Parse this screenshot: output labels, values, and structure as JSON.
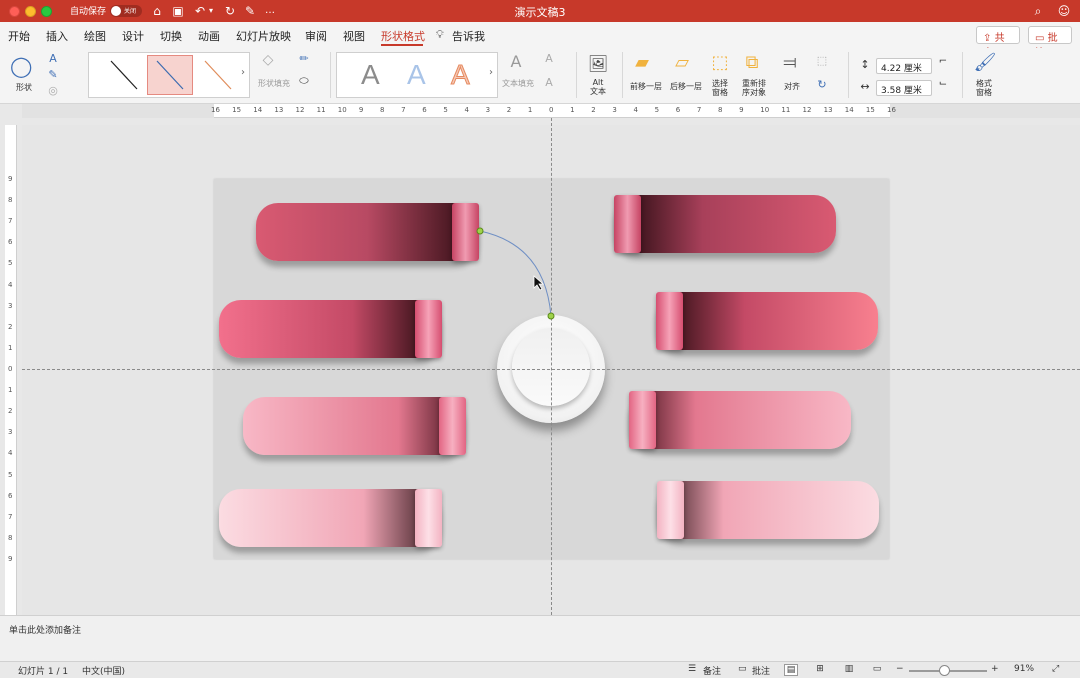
{
  "titlebar": {
    "autosave_label": "自动保存",
    "autosave_state": "关闭",
    "doc_title": "演示文稿3"
  },
  "tabs": [
    {
      "label": "开始"
    },
    {
      "label": "插入"
    },
    {
      "label": "绘图"
    },
    {
      "label": "设计"
    },
    {
      "label": "切换"
    },
    {
      "label": "动画"
    },
    {
      "label": "幻灯片放映"
    },
    {
      "label": "审阅"
    },
    {
      "label": "视图"
    },
    {
      "label": "形状格式",
      "active": true
    },
    {
      "label": "告诉我"
    }
  ],
  "header_buttons": {
    "share": "共享",
    "comment": "批注"
  },
  "ribbon": {
    "shape_label": "形状",
    "shape_fill_label": "形状填充",
    "text_fill_label": "文本填充",
    "alt_text_label": "Alt\n文本",
    "bring_forward": "前移一层",
    "send_backward": "后移一层",
    "selection_pane": "选择\n窗格",
    "reorder": "重新排\n序对象",
    "align": "对齐",
    "height_value": "4.22 厘米",
    "width_value": "3.58 厘米",
    "format_pane": "格式\n窗格"
  },
  "ruler": {
    "h_labels": [
      "16",
      "15",
      "14",
      "13",
      "12",
      "11",
      "10",
      "9",
      "8",
      "7",
      "6",
      "5",
      "4",
      "3",
      "2",
      "1",
      "0",
      "1",
      "2",
      "3",
      "4",
      "5",
      "6",
      "7",
      "8",
      "9",
      "10",
      "11",
      "12",
      "13",
      "14",
      "15",
      "16"
    ],
    "v_labels": [
      "9",
      "8",
      "7",
      "6",
      "5",
      "4",
      "3",
      "2",
      "1",
      "0",
      "1",
      "2",
      "3",
      "4",
      "5",
      "6",
      "7",
      "8",
      "9"
    ]
  },
  "notes": {
    "placeholder": "单击此处添加备注"
  },
  "status": {
    "slide_info": "幻灯片 1 / 1",
    "language": "中文(中国)",
    "notes_btn": "备注",
    "comments_btn": "批注",
    "zoom": "91%"
  },
  "colors": {
    "brand": "#c7392a",
    "ribbon_bg": "#f4f4f4",
    "slide_bg": "#d8d8d8"
  }
}
